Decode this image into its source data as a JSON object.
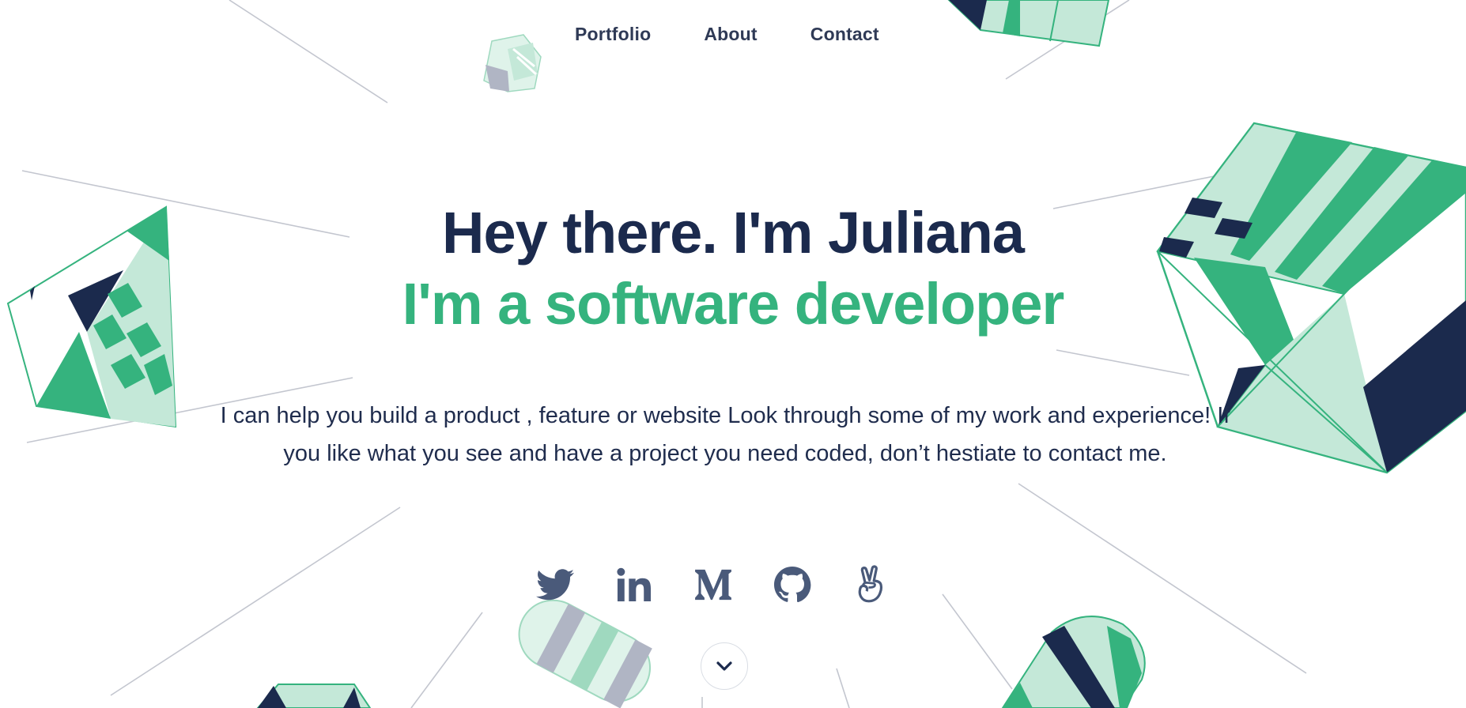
{
  "nav": {
    "items": [
      {
        "label": "Portfolio"
      },
      {
        "label": "About"
      },
      {
        "label": "Contact"
      }
    ]
  },
  "hero": {
    "title": "Hey there. I'm Juliana",
    "subtitle": "I'm a software developer",
    "intro": "I can help you build a product , feature or website Look through some of my work and experience! If you like what you see and have a project you need coded, don’t hestiate to contact me."
  },
  "socials": [
    {
      "icon": "twitter-icon"
    },
    {
      "icon": "linkedin-icon"
    },
    {
      "icon": "medium-icon"
    },
    {
      "icon": "github-icon"
    },
    {
      "icon": "angellist-icon"
    }
  ],
  "colors": {
    "navy": "#1b2a4d",
    "green": "#35b37e",
    "mint": "#c4e8d8",
    "icon": "#4a5a7a"
  }
}
